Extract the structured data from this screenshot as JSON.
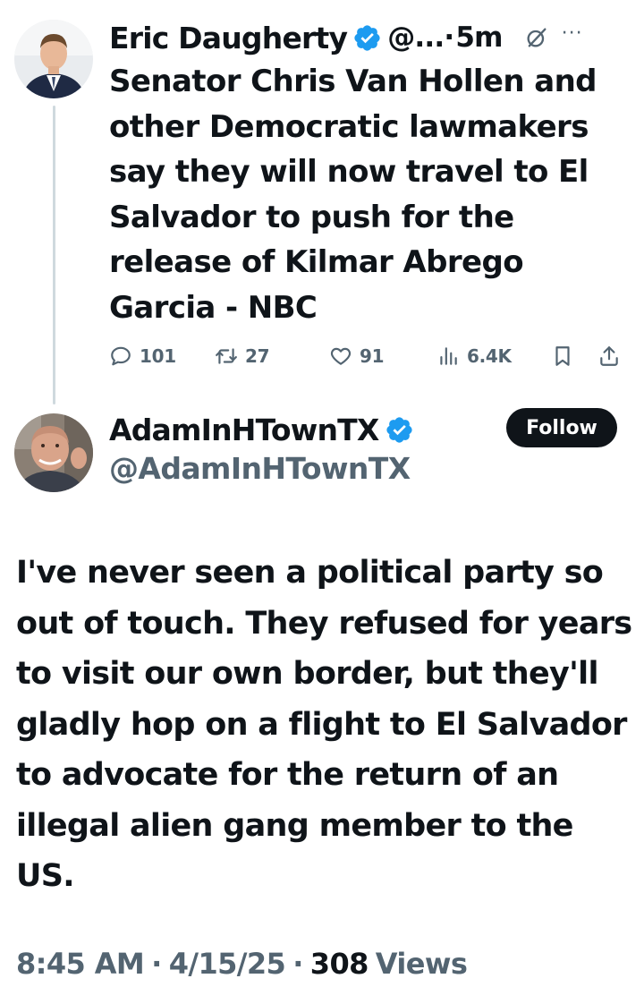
{
  "parent_tweet": {
    "display_name": "Eric Daugherty",
    "handle_truncated": "@...",
    "separator": "·",
    "time_ago": "5m",
    "text": "Senator Chris Van Hollen and other Democratic lawmakers say they will now travel to El Salvador to push for the release of Kilmar Abrego Garcia - NBC",
    "more_label": "···",
    "stats": {
      "replies": "101",
      "retweets": "27",
      "likes": "91",
      "views": "6.4K"
    }
  },
  "reply_tweet": {
    "display_name": "AdamInHTownTX",
    "handle": "@AdamInHTownTX",
    "follow_label": "Follow",
    "text": "I've never seen a political party so out of touch. They refused for years to visit our own border, but they'll gladly hop on a flight to El Salvador to advocate for the return of an illegal alien gang member to the US.",
    "time": "8:45 AM",
    "separator": "·",
    "date": "4/15/25",
    "views_count": "308",
    "views_label": "Views"
  },
  "colors": {
    "text_primary": "#0f1419",
    "text_secondary": "#536471",
    "verified_blue": "#1d9bf0",
    "thread_line": "#cfd9de",
    "follow_bg": "#0f1419"
  },
  "icons": {
    "reply": "speech-bubble-icon",
    "retweet": "retweet-icon",
    "like": "heart-icon",
    "views": "bar-chart-icon",
    "bookmark": "bookmark-icon",
    "share": "share-icon",
    "verified": "verified-badge-icon",
    "grok": "grok-icon"
  }
}
